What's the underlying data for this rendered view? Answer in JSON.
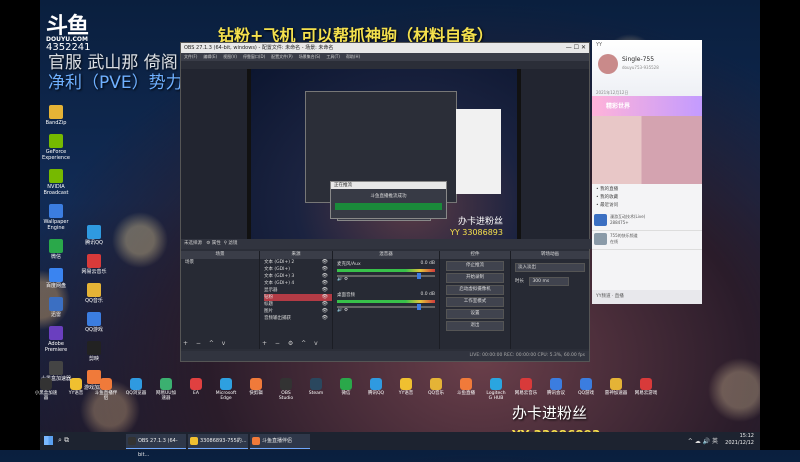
{
  "overlay": {
    "logo_main": "斗鱼",
    "logo_sub": "DOUYU.COM",
    "room_id": "4352241",
    "headline": "钻粉+飞机 可以帮抓神驹（材料自备）",
    "line1": "官服  武山那  倚阁",
    "line2": "净利（PVE）势力：金色传说"
  },
  "desktop_icons": [
    {
      "label": "BandZip",
      "color": "#e5b336"
    },
    {
      "label": "GeForce Experience",
      "color": "#76b900"
    },
    {
      "label": "NVIDIA Broadcast",
      "color": "#76b900"
    },
    {
      "label": "Wallpaper Engine",
      "color": "#3b7de0"
    },
    {
      "label": "微信",
      "color": "#2aa84a"
    },
    {
      "label": "百度网盘",
      "color": "#3a84f0"
    },
    {
      "label": "迅雷",
      "color": "#3b6fc2"
    },
    {
      "label": "Adobe Premiere",
      "color": "#6a3fbf"
    },
    {
      "label": "小黑盒加速器",
      "color": "#444"
    }
  ],
  "desktop_icons2": [
    {
      "label": "腾讯QQ",
      "color": "#2f9ae0"
    },
    {
      "label": "网易云音乐",
      "color": "#d83a3a"
    },
    {
      "label": "QQ音乐",
      "color": "#e5b336"
    },
    {
      "label": "QQ游戏",
      "color": "#3b7de0"
    },
    {
      "label": "剪映",
      "color": "#222"
    },
    {
      "label": "游戏加加",
      "color": "#f07a3a"
    }
  ],
  "obs": {
    "title": "OBS 27.1.3 (64-bit, windows) - 配置文件: 未命名 - 场景: 未命名",
    "menu": [
      "文件(F)",
      "编辑(E)",
      "视图(V)",
      "停靠窗口(D)",
      "配置文件(P)",
      "场景集合(S)",
      "工具(T)",
      "帮助(H)"
    ],
    "status_strip": "未选择源",
    "prop_btn": "属性",
    "filter_btn": "滤镜",
    "docks": {
      "scenes": "场景",
      "sources": "来源",
      "mixer": "混音器",
      "transitions": "转场动画",
      "controls": "控件"
    },
    "scene_items": [
      "场景"
    ],
    "source_items": [
      "文本 (GDI+) 2",
      "文本 (GDI+)",
      "文本 (GDI+) 3",
      "文本 (GDI+) 4",
      "显示器",
      "钻粉",
      "标题",
      "图片",
      "音频输出捕获"
    ],
    "mixer_items": [
      {
        "name": "麦克风/Aux",
        "db": "0.0 dB"
      },
      {
        "name": "桌面音频",
        "db": "0.0 dB"
      }
    ],
    "controls": [
      "停止推流",
      "开始录制",
      "启动虚拟摄像机",
      "工作室模式",
      "设置",
      "退出"
    ],
    "transition_value": "淡入淡出",
    "duration_label": "时长",
    "duration_value": "300 ms",
    "status_bar": "LIVE: 00:00:00  REC: 00:00:00  CPU: 5.3%, 60.00 fps"
  },
  "dialog": {
    "title": "正在推流",
    "body": "斗鱼直播推流成功"
  },
  "yy": {
    "top": "YY",
    "name": "Single-755",
    "id": "douyu753-935528",
    "date": "2021年12月12日",
    "banner": "精彩世界",
    "menu": [
      "我的直播",
      "我的收藏",
      "最近访问"
    ],
    "item1": "漫游互动技术(Live)",
    "item1_sub": "288475+",
    "item2": "755的快乐频道",
    "item2_sub": "在线",
    "bottom": "YY频道 · 直播"
  },
  "dock_row": [
    {
      "label": "小黑盒加速器",
      "color": "#333"
    },
    {
      "label": "YY语音",
      "color": "#f0c030"
    },
    {
      "label": "斗鱼直播伴侣",
      "color": "#f07a3a"
    },
    {
      "label": "QQ浏览器",
      "color": "#2f9ae0"
    },
    {
      "label": "网易UU加速器",
      "color": "#3bb070"
    },
    {
      "label": "EA",
      "color": "#e04040"
    },
    {
      "label": "Microsoft Edge",
      "color": "#2ea0e0"
    },
    {
      "label": "快剪辑",
      "color": "#f07a3a"
    },
    {
      "label": "OBS Studio",
      "color": "#333"
    },
    {
      "label": "Steam",
      "color": "#2a475e"
    },
    {
      "label": "微信",
      "color": "#2aa84a"
    },
    {
      "label": "腾讯QQ",
      "color": "#2f9ae0"
    },
    {
      "label": "YY语音",
      "color": "#f0c030"
    },
    {
      "label": "QQ音乐",
      "color": "#e5b336"
    },
    {
      "label": "斗鱼直播",
      "color": "#f07a3a"
    },
    {
      "label": "Logitech G HUB",
      "color": "#2aa5e0"
    },
    {
      "label": "网易云音乐",
      "color": "#d83a3a"
    },
    {
      "label": "腾讯会议",
      "color": "#3b7de0"
    },
    {
      "label": "QQ游戏",
      "color": "#3b7de0"
    },
    {
      "label": "雷神加速器",
      "color": "#e5b336"
    },
    {
      "label": "网易云游戏",
      "color": "#d83a3a"
    }
  ],
  "watermark": {
    "line1": "办卡进粉丝",
    "line2": "YY 33086893"
  },
  "taskbar": {
    "apps": [
      {
        "label": "OBS 27.1.3 (64-bit...",
        "color": "#333"
      },
      {
        "label": "33086893-755的...",
        "color": "#f0c030"
      },
      {
        "label": "斗鱼直播伴侣",
        "color": "#f07a3a"
      }
    ],
    "time": "15:12",
    "date": "2021/12/12"
  }
}
